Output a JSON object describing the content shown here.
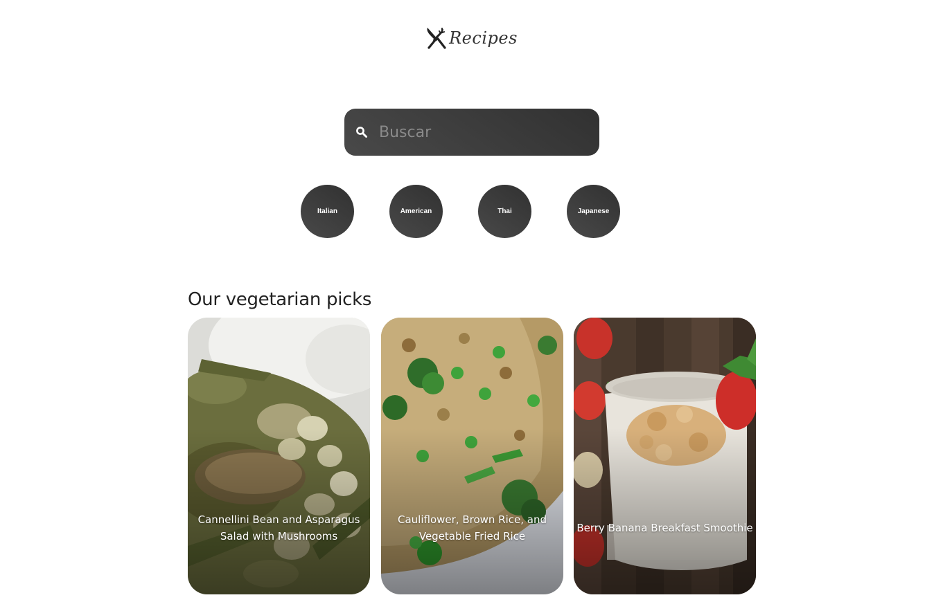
{
  "header": {
    "logo_text": "Recipes",
    "logo_icon": "fork-knife-icon"
  },
  "search": {
    "placeholder": "Buscar",
    "value": "",
    "icon": "search-icon"
  },
  "categories": [
    {
      "label": "Italian"
    },
    {
      "label": "American"
    },
    {
      "label": "Thai"
    },
    {
      "label": "Japanese"
    }
  ],
  "section": {
    "title": "Our vegetarian picks"
  },
  "recipes": [
    {
      "title": "Cannellini Bean and Asparagus Salad with Mushrooms"
    },
    {
      "title": "Cauliflower, Brown Rice, and Vegetable Fried Rice"
    },
    {
      "title": "Berry Banana Breakfast Smoothie"
    }
  ],
  "colors": {
    "accent_dark": "#313131",
    "accent_light": "#494949",
    "background": "#ffffff"
  }
}
